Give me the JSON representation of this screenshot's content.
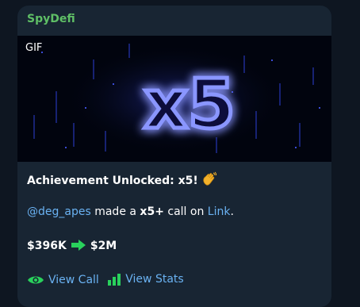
{
  "message": {
    "sender": "SpyDefi",
    "media_badge": "GIF",
    "gif_text": "x5",
    "title": "Achievement Unlocked: x5!",
    "title_emoji_icon": "waving-hand-icon",
    "mention": "@deg_apes",
    "body_middle": " made a ",
    "multiplier": "x5+",
    "body_call": " call on ",
    "link_text": "Link",
    "body_end": ".",
    "from_value": "$396K",
    "to_value": "$2M",
    "arrow_icon": "green-right-arrow-icon",
    "view_call_label": "View Call",
    "view_call_icon": "eye-icon",
    "view_stats_label": "View Stats",
    "view_stats_icon": "bar-chart-icon"
  },
  "colors": {
    "background": "#0e1621",
    "bubble": "#182533",
    "sender": "#5fbf66",
    "link": "#6ab2f2",
    "accent_green": "#29d15c",
    "glow": "#7f8cff"
  }
}
